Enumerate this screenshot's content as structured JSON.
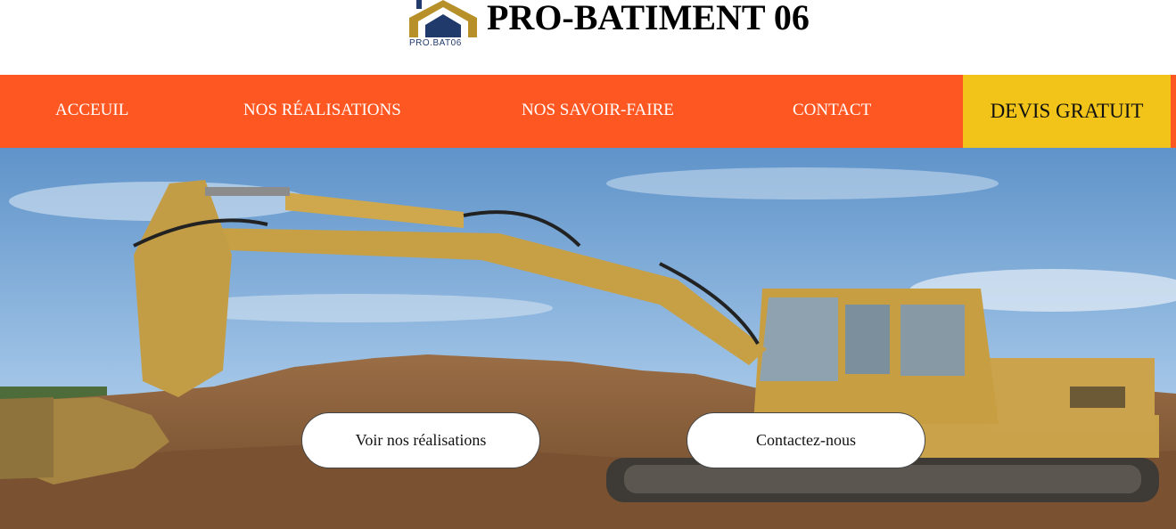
{
  "header": {
    "logo_text": "PRO.BAT06",
    "site_title": "PRO-BATIMENT 06"
  },
  "nav": {
    "items": [
      {
        "label": "ACCEUIL"
      },
      {
        "label": "NOS RÉALISATIONS"
      },
      {
        "label": "NOS SAVOIR-FAIRE"
      },
      {
        "label": "CONTACT"
      }
    ],
    "cta_label": "DEVIS GRATUIT"
  },
  "hero": {
    "image_icon": "excavator-photo",
    "buttons": [
      {
        "label": "Voir nos réalisations"
      },
      {
        "label": "Contactez-nous"
      }
    ]
  },
  "colors": {
    "nav_bg": "#ff5722",
    "cta_bg": "#f2c419",
    "logo_blue": "#1f3a6b",
    "logo_gold": "#b8902a"
  }
}
